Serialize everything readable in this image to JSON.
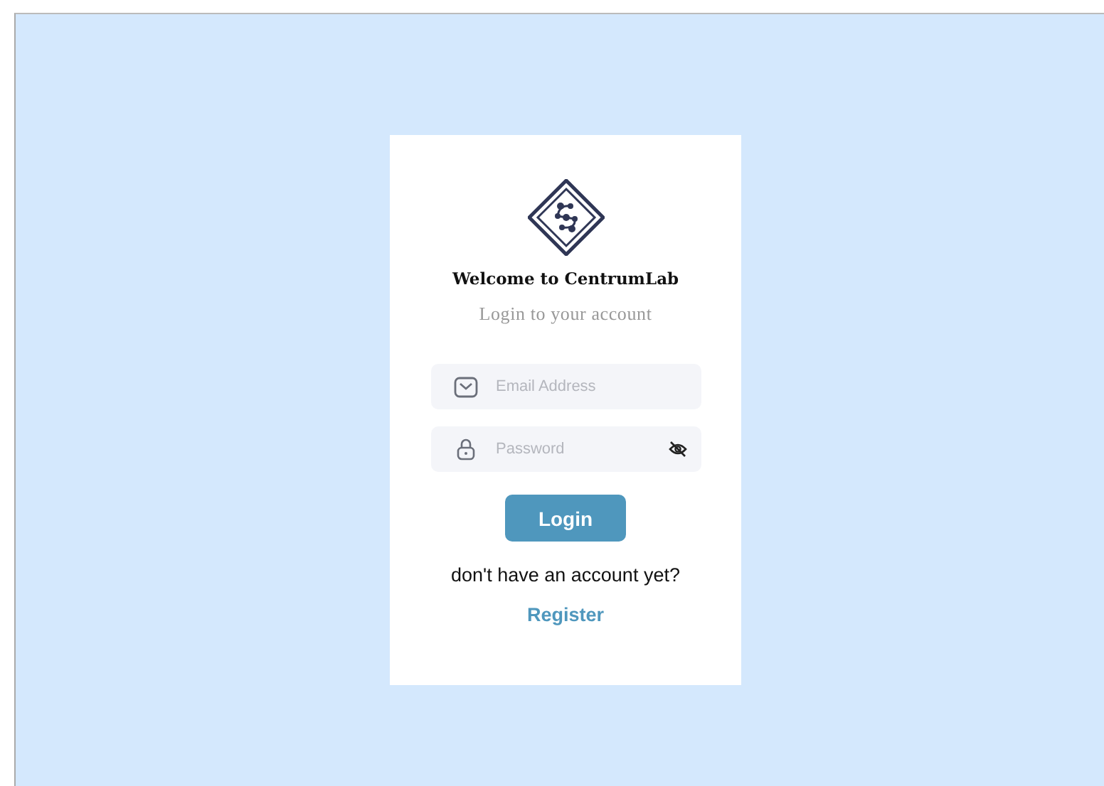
{
  "card": {
    "title": "Welcome to CentrumLab",
    "subtitle": "Login to your account"
  },
  "fields": [
    {
      "kind": "email",
      "placeholder": "Email Address"
    },
    {
      "kind": "password",
      "placeholder": "Password"
    }
  ],
  "login_button": "Login",
  "prompt": "don't have an account yet?",
  "register_link": "Register"
}
